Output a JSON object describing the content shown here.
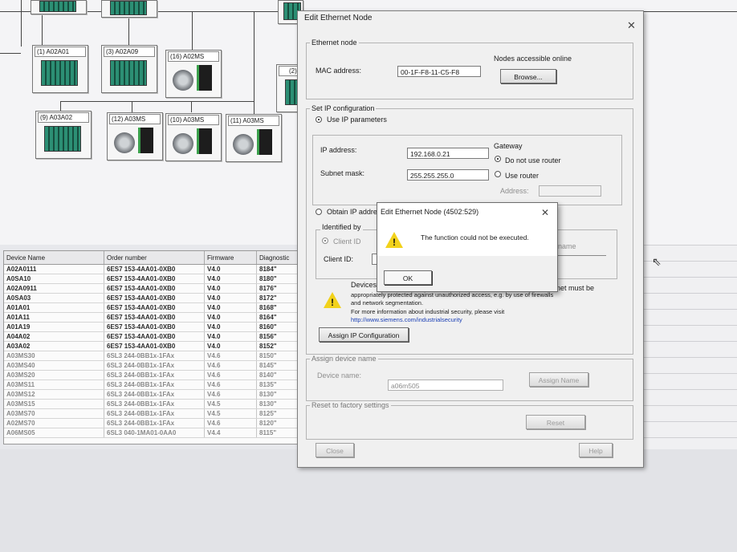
{
  "network": {
    "nodes_row1": [
      {
        "label": "(1) A02A01",
        "kind": "plc"
      },
      {
        "label": "(3) A02A09",
        "kind": "plc"
      },
      {
        "label": "(16) A02MS",
        "kind": "motor"
      },
      {
        "label": "(2)",
        "kind": "plc"
      }
    ],
    "nodes_row2": [
      {
        "label": "(9) A03A02",
        "kind": "plc"
      },
      {
        "label": "(12) A03MS",
        "kind": "motor"
      },
      {
        "label": "(10) A03MS",
        "kind": "motor"
      },
      {
        "label": "(11) A03MS",
        "kind": "motor"
      }
    ]
  },
  "device_table": {
    "columns": [
      "Device Name",
      "Order number",
      "Firmware",
      "Diagnostic"
    ],
    "rows": [
      [
        "A02A0111",
        "6ES7 153-4AA01-0XB0",
        "V4.0",
        "8184\""
      ],
      [
        "A0SA10",
        "6ES7 153-4AA01-0XB0",
        "V4.0",
        "8180\""
      ],
      [
        "A02A0911",
        "6ES7 153-4AA01-0XB0",
        "V4.0",
        "8176\""
      ],
      [
        "A0SA03",
        "6ES7 153-4AA01-0XB0",
        "V4.0",
        "8172\""
      ],
      [
        "A01A01",
        "6ES7 153-4AA01-0XB0",
        "V4.0",
        "8168\""
      ],
      [
        "A01A11",
        "6ES7 153-4AA01-0XB0",
        "V4.0",
        "8164\""
      ],
      [
        "A01A19",
        "6ES7 153-4AA01-0XB0",
        "V4.0",
        "8160\""
      ],
      [
        "A04A02",
        "6ES7 153-4AA01-0XB0",
        "V4.0",
        "8156\""
      ],
      [
        "A03A02",
        "6ES7 153-4AA01-0XB0",
        "V4.0",
        "8152\""
      ],
      [
        "A03MS30",
        "6SL3 244-0BB1x-1FAx",
        "V4.6",
        "8150\""
      ],
      [
        "A03MS40",
        "6SL3 244-0BB1x-1FAx",
        "V4.6",
        "8145\""
      ],
      [
        "A03MS20",
        "6SL3 244-0BB1x-1FAx",
        "V4.6",
        "8140\""
      ],
      [
        "A03MS11",
        "6SL3 244-0BB1x-1FAx",
        "V4.6",
        "8135\""
      ],
      [
        "A03MS12",
        "6SL3 244-0BB1x-1FAx",
        "V4.6",
        "8130\""
      ],
      [
        "A03MS15",
        "6SL3 244-0BB1x-1FAx",
        "V4.5",
        "8130\""
      ],
      [
        "A03MS70",
        "6SL3 244-0BB1x-1FAx",
        "V4.5",
        "8125\""
      ],
      [
        "A02MS70",
        "6SL3 244-0BB1x-1FAx",
        "V4.6",
        "8120\""
      ],
      [
        "A06MS05",
        "6SL3 040-1MA01-0AA0",
        "V4.4",
        "8115\""
      ]
    ]
  },
  "dialog": {
    "title": "Edit Ethernet Node",
    "ethernet_node": {
      "legend": "Ethernet node",
      "mac_label": "MAC address:",
      "mac_value": "00-1F-F8-11-C5-F8",
      "nodes_online_label": "Nodes accessible online",
      "browse_label": "Browse..."
    },
    "ip_config": {
      "legend": "Set IP configuration",
      "use_ip_label": "Use IP parameters",
      "ip_label": "IP address:",
      "ip_value": "192.168.0.21",
      "subnet_label": "Subnet mask:",
      "subnet_value": "255.255.255.0",
      "gateway_label": "Gateway",
      "no_router_label": "Do not use router",
      "use_router_label": "Use router",
      "address_label": "Address:",
      "obtain_label": "Obtain IP addre",
      "identified_by_label": "Identified by",
      "client_id_radio_label": "Client ID",
      "client_id_label": "Client ID:",
      "name_label": "name"
    },
    "security": {
      "line0": "Devices",
      "line0_right": "net must be",
      "line1": "appropriately protected against unauthorized access, e.g. by use of firewalls",
      "line2": "and network segmentation.",
      "line3": "For more information about industrial security, please visit",
      "link": "http://www.siemens.com/industrialsecurity"
    },
    "assign_ip_button": "Assign IP Configuration",
    "assign_name": {
      "legend": "Assign device name",
      "device_name_label": "Device name:",
      "device_name_value": "a06m505",
      "assign_name_button": "Assign Name"
    },
    "reset": {
      "legend": "Reset to factory settings",
      "reset_button": "Reset"
    },
    "close_button": "Close",
    "help_button": "Help"
  },
  "error_dialog": {
    "title": "Edit Ethernet Node (4502:529)",
    "message": "The function could not be executed.",
    "ok_label": "OK"
  }
}
